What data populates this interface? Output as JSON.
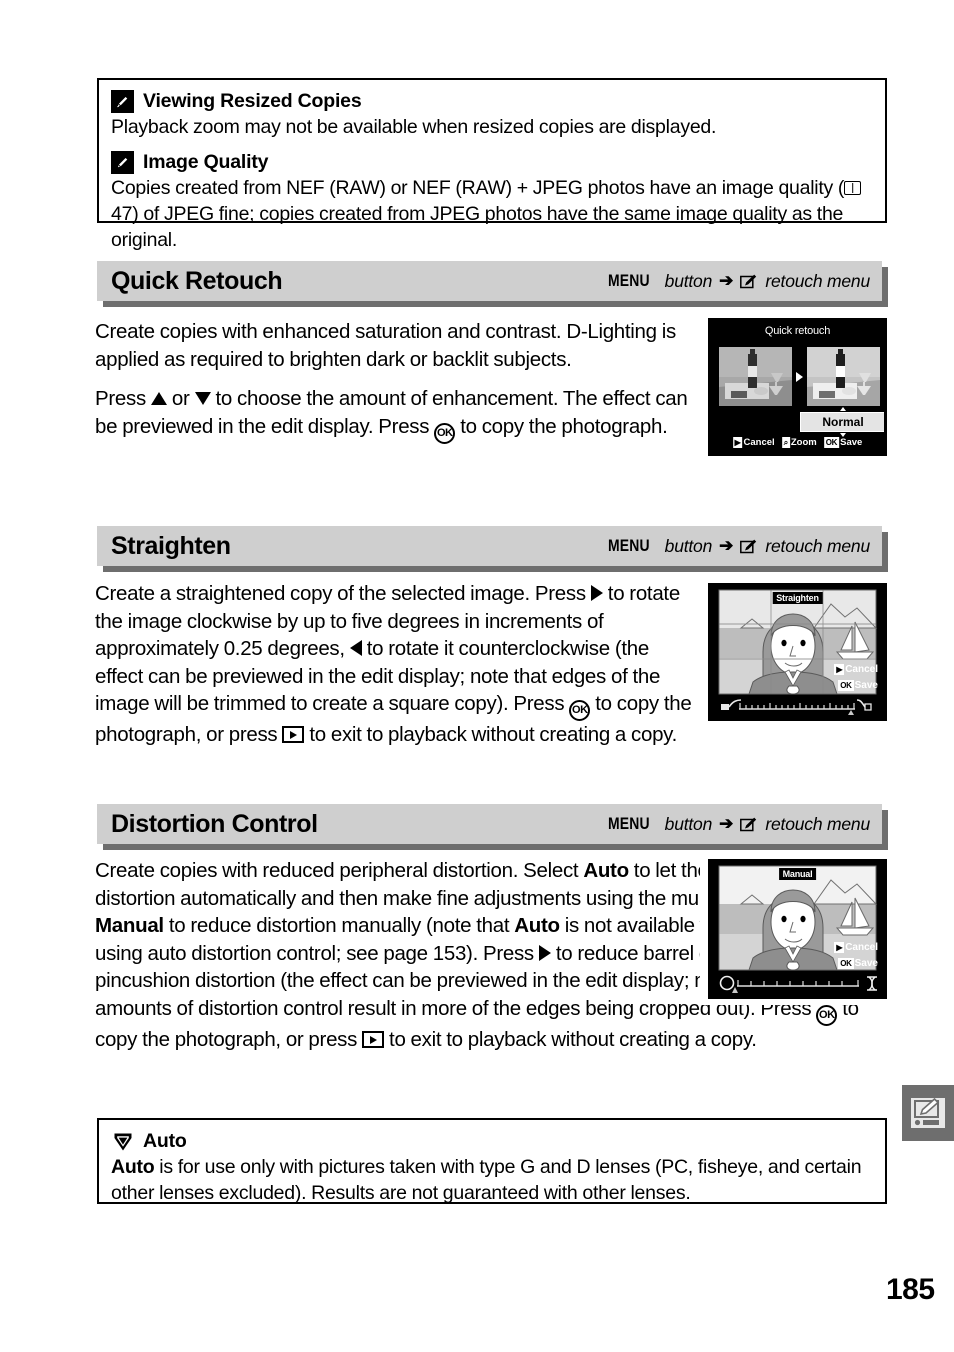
{
  "page": {
    "number": "185"
  },
  "notes_top": {
    "items": [
      {
        "icon": "pencil-note-icon",
        "title": "Viewing Resized Copies",
        "body": "Playback zoom may not be available when resized copies are displayed."
      },
      {
        "icon": "pencil-note-icon",
        "title": "Image Quality",
        "body_parts": {
          "p1": "Copies created from NEF (RAW) or NEF (RAW) + JPEG photos have an image quality (",
          "ref": "47",
          "p2": ") of JPEG fine; copies created from JPEG photos have the same image quality as the original."
        }
      }
    ]
  },
  "sections": [
    {
      "id": "quick-retouch",
      "title": "Quick Retouch",
      "path": {
        "menu_word": "MENU",
        "button_word": "button",
        "arrow": "➔",
        "icon": "retouch-menu-icon",
        "menu_name": "retouch menu"
      },
      "body": {
        "p1": "Create copies with enhanced saturation and contrast.  D-Lighting is applied as required to brighten dark or backlit subjects.",
        "p2_a": "Press ",
        "p2_b": " or ",
        "p2_c": " to choose the amount of enhancement.  The effect can be previewed in the edit display.  Press ",
        "p2_d": " to copy the photograph."
      },
      "figure": {
        "title": "Quick retouch",
        "option": "Normal",
        "buttons": [
          {
            "badge": "▶",
            "label": "Cancel"
          },
          {
            "badge": "⌕",
            "label": "Zoom"
          },
          {
            "badge": "OK",
            "label": "Save"
          }
        ]
      }
    },
    {
      "id": "straighten",
      "title": "Straighten",
      "path": {
        "menu_word": "MENU",
        "button_word": "button",
        "arrow": "➔",
        "icon": "retouch-menu-icon",
        "menu_name": "retouch menu"
      },
      "body": {
        "a": "Create a straightened copy of the selected image.  Press ",
        "b": " to rotate the image clockwise by up to five degrees in increments of approximately 0.25 degrees, ",
        "c": " to rotate it counterclockwise (the effect can be previewed in the edit display; note that edges of the image will be trimmed to create a square copy).  Press ",
        "d": " to copy the photograph, or press ",
        "e": " to exit to playback without creating a copy."
      },
      "figure": {
        "title": "Straighten",
        "buttons": [
          {
            "badge": "▶",
            "label": "Cancel"
          },
          {
            "badge": "OK",
            "label": "Save"
          }
        ]
      }
    },
    {
      "id": "distortion-control",
      "title": "Distortion Control",
      "path": {
        "menu_word": "MENU",
        "button_word": "button",
        "arrow": "➔",
        "icon": "retouch-menu-icon",
        "menu_name": "retouch menu"
      },
      "body": {
        "a": "Create copies with reduced peripheral distortion.  Select ",
        "auto1": "Auto",
        "b": " to let the camera correct distortion automatically and then make fine adjustments using the multi selector, or select ",
        "manual": "Manual",
        "c": " to reduce distortion manually (note that ",
        "auto2": "Auto",
        "d": " is not available with photos taken using auto distortion control; see page 153).  Press ",
        "e": " to reduce barrel distortion, ",
        "f": " to reduce pincushion distortion (the effect can be previewed in the edit display; note that greater amounts of distortion control result in more of the edges being cropped out).  Press ",
        "g": " to copy the photograph, or press ",
        "h": " to exit to playback without creating a copy."
      },
      "figure": {
        "title": "Manual",
        "buttons": [
          {
            "badge": "▶",
            "label": "Cancel"
          },
          {
            "badge": "OK",
            "label": "Save"
          }
        ]
      }
    }
  ],
  "note_bottom": {
    "icon": "caution-icon",
    "title": "Auto",
    "body_a": "Auto",
    "body_b": " is for use only with pictures taken with type G and D lenses (PC, fisheye, and certain other lenses excluded).  Results are not guaranteed with other lenses."
  },
  "side_tab": {
    "icon": "retouch-menu-icon"
  },
  "colors": {
    "header_bg": "#cfcfcf",
    "header_shadow": "#6e6e6e",
    "tab_bg": "#6e6e6e"
  }
}
